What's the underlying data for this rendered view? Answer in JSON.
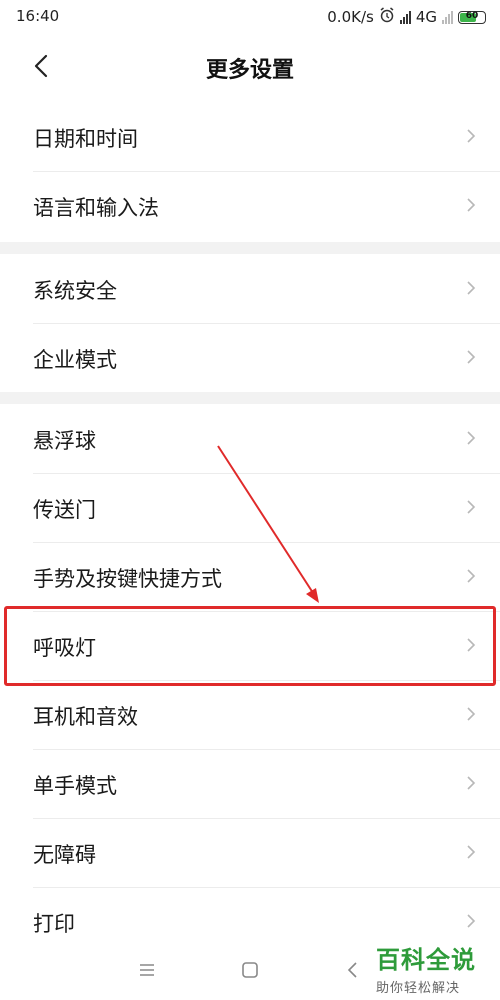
{
  "status_bar": {
    "time": "16:40",
    "network_speed": "0.0K/s",
    "network_type": "4G",
    "battery_level": "60",
    "icons": [
      "alarm-icon",
      "hd-signal-icon",
      "signal-icon",
      "battery-icon"
    ]
  },
  "header": {
    "title": "更多设置",
    "back_icon": "back-arrow-icon"
  },
  "groups": [
    {
      "items": [
        {
          "label": "日期和时间"
        },
        {
          "label": "语言和输入法"
        }
      ]
    },
    {
      "items": [
        {
          "label": "系统安全"
        },
        {
          "label": "企业模式"
        }
      ]
    },
    {
      "items": [
        {
          "label": "悬浮球"
        },
        {
          "label": "传送门"
        },
        {
          "label": "手势及按键快捷方式"
        },
        {
          "label": "呼吸灯",
          "highlighted": true
        },
        {
          "label": "耳机和音效"
        },
        {
          "label": "单手模式"
        },
        {
          "label": "无障碍"
        },
        {
          "label": "打印"
        }
      ]
    }
  ],
  "annotation": {
    "color": "#e02a2a",
    "target": "呼吸灯"
  },
  "navbar": {
    "icons": [
      "menu-icon",
      "home-icon",
      "back-icon"
    ]
  },
  "watermark": {
    "brand": "百科全说",
    "slogan": "助你轻松解决"
  }
}
